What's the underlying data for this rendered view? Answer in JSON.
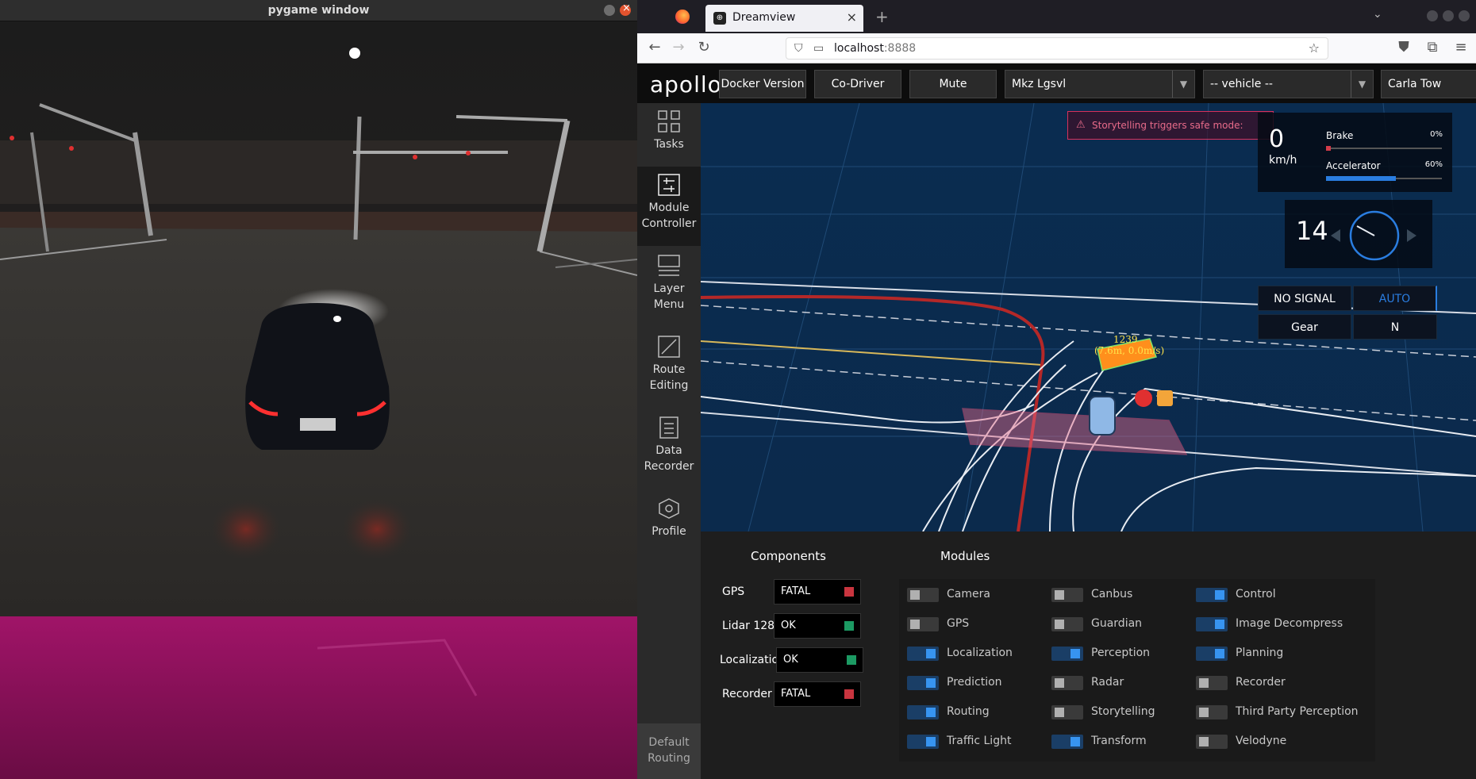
{
  "pygame": {
    "title": "pygame window"
  },
  "browser": {
    "tab_title": "Dreamview",
    "url_host": "localhost",
    "url_port": ":8888"
  },
  "dreamview": {
    "logo": "apollo",
    "header": {
      "buttons": [
        "Docker Version",
        "Co-Driver",
        "Mute"
      ],
      "vehicle_select": "Mkz Lgsvl",
      "vehicle_placeholder": "-- vehicle --",
      "map_select": "Carla Tow"
    },
    "sidebar": {
      "items": [
        {
          "label_1": "Tasks",
          "label_2": "",
          "icon": "grid-icon"
        },
        {
          "label_1": "Module",
          "label_2": "Controller",
          "icon": "controller-icon"
        },
        {
          "label_1": "Layer",
          "label_2": "Menu",
          "icon": "layers-icon"
        },
        {
          "label_1": "Route",
          "label_2": "Editing",
          "icon": "route-icon"
        },
        {
          "label_1": "Data",
          "label_2": "Recorder",
          "icon": "recorder-icon"
        },
        {
          "label_1": "Profile",
          "label_2": "",
          "icon": "hexagon-icon"
        }
      ],
      "default_routing_1": "Default",
      "default_routing_2": "Routing"
    },
    "scene": {
      "safe_mode_banner": "Storytelling triggers safe mode:",
      "obstacle_id": "1239",
      "obstacle_info": "(7.6m, 0.0m/s)"
    },
    "dashboard": {
      "speed": "0",
      "speed_unit": "km/h",
      "brake_label": "Brake",
      "brake_pct": "0%",
      "brake_value": 0.0,
      "accel_label": "Accelerator",
      "accel_pct": "60%",
      "accel_value": 0.6,
      "steering": "14",
      "signal": "NO SIGNAL",
      "mode": "AUTO",
      "gear_label": "Gear",
      "gear_value": "N"
    },
    "components_title": "Components",
    "components": [
      {
        "name": "GPS",
        "status": "FATAL",
        "color": "#c9353f"
      },
      {
        "name": "Lidar 128",
        "status": "OK",
        "color": "#1c9a63"
      },
      {
        "name": "Localization",
        "status": "OK",
        "color": "#1c9a63"
      },
      {
        "name": "Recorder",
        "status": "FATAL",
        "color": "#c9353f"
      }
    ],
    "modules_title": "Modules",
    "modules": [
      {
        "name": "Camera",
        "on": false
      },
      {
        "name": "GPS",
        "on": false
      },
      {
        "name": "Localization",
        "on": true
      },
      {
        "name": "Prediction",
        "on": true
      },
      {
        "name": "Routing",
        "on": true
      },
      {
        "name": "Traffic Light",
        "on": true
      },
      {
        "name": "Canbus",
        "on": false
      },
      {
        "name": "Guardian",
        "on": false
      },
      {
        "name": "Perception",
        "on": true
      },
      {
        "name": "Radar",
        "on": false
      },
      {
        "name": "Storytelling",
        "on": false
      },
      {
        "name": "Transform",
        "on": true
      },
      {
        "name": "Control",
        "on": true
      },
      {
        "name": "Image Decompress",
        "on": true
      },
      {
        "name": "Planning",
        "on": true
      },
      {
        "name": "Recorder",
        "on": false
      },
      {
        "name": "Third Party Perception",
        "on": false
      },
      {
        "name": "Velodyne",
        "on": false
      }
    ]
  }
}
